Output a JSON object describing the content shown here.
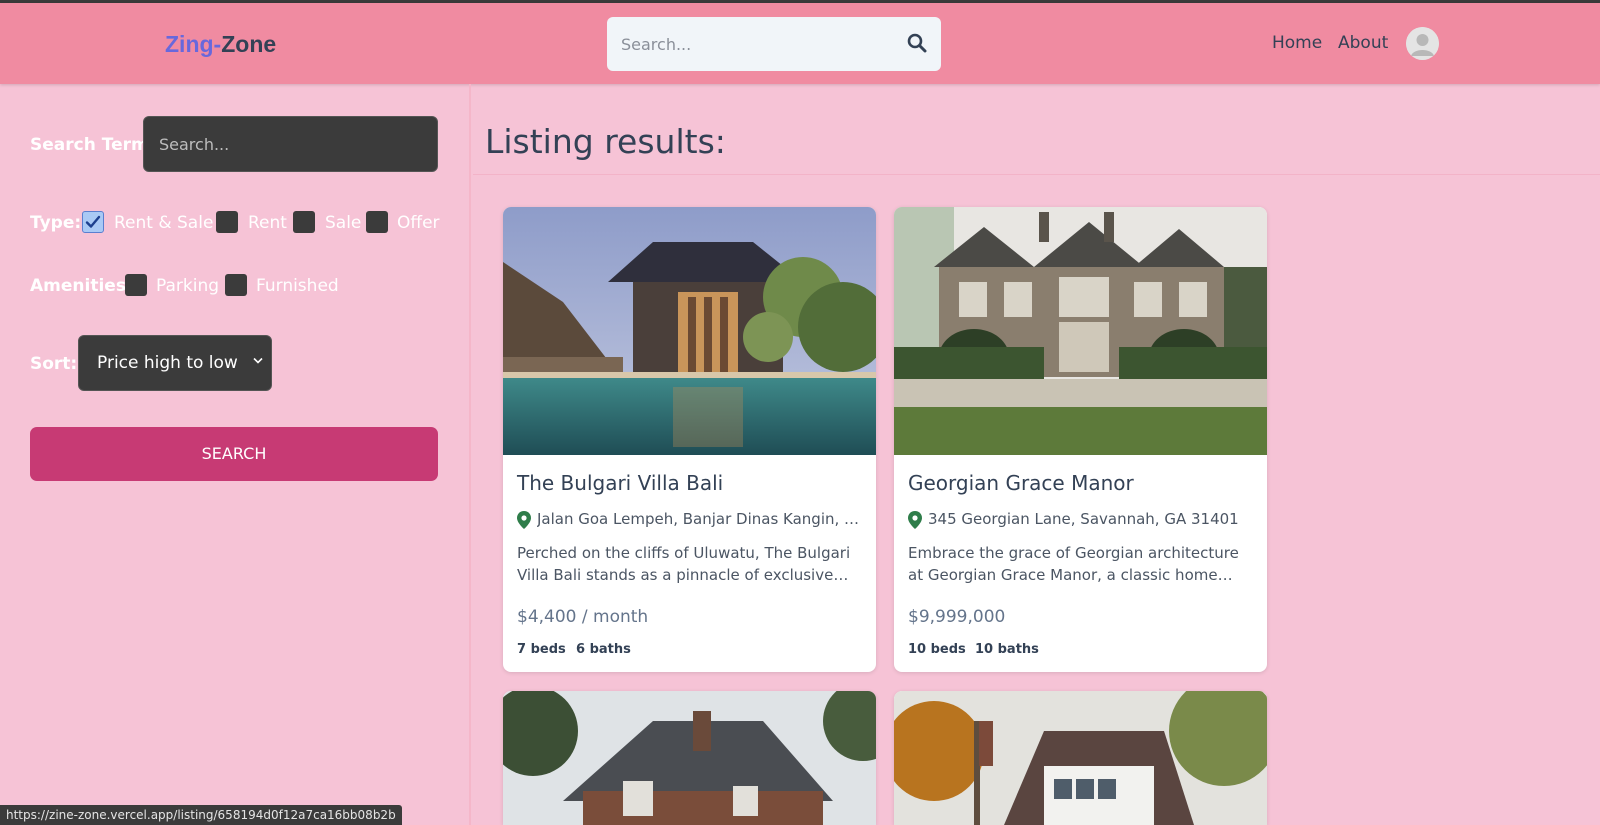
{
  "header": {
    "logo_part1": "Zing",
    "logo_dash": "-",
    "logo_part2": "Zone",
    "search_placeholder": "Search...",
    "nav": {
      "home": "Home",
      "about": "About"
    }
  },
  "sidebar": {
    "search_label": "Search Term:",
    "search_placeholder": "Search...",
    "type_label": "Type:",
    "type_options": [
      {
        "label": "Rent & Sale",
        "checked": true
      },
      {
        "label": "Rent",
        "checked": false
      },
      {
        "label": "Sale",
        "checked": false
      },
      {
        "label": "Offer",
        "checked": false
      }
    ],
    "amenities_label": "Amenities:",
    "amenities_options": [
      {
        "label": "Parking",
        "checked": false
      },
      {
        "label": "Furnished",
        "checked": false
      }
    ],
    "sort_label": "Sort:",
    "sort_value": "Price high to low",
    "search_button": "SEARCH"
  },
  "main": {
    "title": "Listing results:",
    "listings": [
      {
        "name": "The Bulgari Villa Bali",
        "address": "Jalan Goa Lempeh, Banjar Dinas Kangin, Uluwatu, Bali",
        "description": "Perched on the cliffs of Uluwatu, The Bulgari Villa Bali stands as a pinnacle of exclusive luxury. This villa offers...",
        "price": "$4,400 / month",
        "beds": "7 beds",
        "baths": "6 baths"
      },
      {
        "name": "Georgian Grace Manor",
        "address": "345 Georgian Lane, Savannah, GA 31401",
        "description": "Embrace the grace of Georgian architecture at Georgian Grace Manor, a classic home featuring...",
        "price": "$9,999,000",
        "beds": "10 beds",
        "baths": "10 baths"
      }
    ]
  },
  "status_bar": "https://zine-zone.vercel.app/listing/658194d0f12a7ca16bb08b2b",
  "colors": {
    "header_bg": "#f08ba1",
    "page_bg": "#f6c3d6",
    "button": "#c73a74",
    "logo_accent": "#6868dc"
  }
}
